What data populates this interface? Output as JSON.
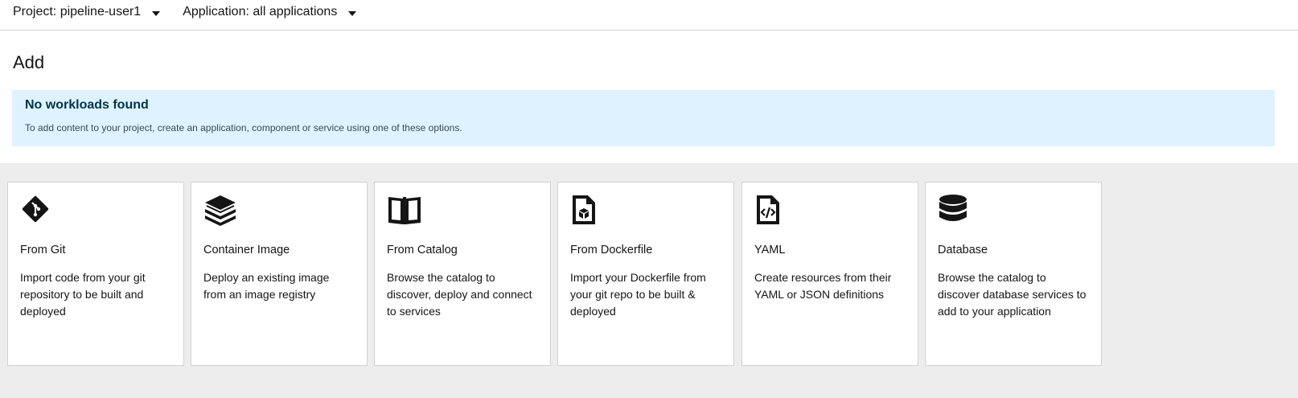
{
  "topbar": {
    "project_label": "Project: pipeline-user1",
    "application_label": "Application: all applications"
  },
  "page": {
    "title": "Add"
  },
  "alert": {
    "title": "No workloads found",
    "body": "To add content to your project, create an application, component or service using one of these options."
  },
  "cards": [
    {
      "icon": "git-icon",
      "title": "From Git",
      "description": "Import code from your git repository to be built and deployed"
    },
    {
      "icon": "layers-icon",
      "title": "Container Image",
      "description": "Deploy an existing image from an image registry"
    },
    {
      "icon": "catalog-book-icon",
      "title": "From Catalog",
      "description": "Browse the catalog to discover, deploy and connect to services"
    },
    {
      "icon": "dockerfile-icon",
      "title": "From Dockerfile",
      "description": "Import your Dockerfile from your git repo to be built & deployed"
    },
    {
      "icon": "yaml-code-file-icon",
      "title": "YAML",
      "description": "Create resources from their YAML or JSON definitions"
    },
    {
      "icon": "database-icon",
      "title": "Database",
      "description": "Browse the catalog to discover database services to add to your application"
    }
  ]
}
